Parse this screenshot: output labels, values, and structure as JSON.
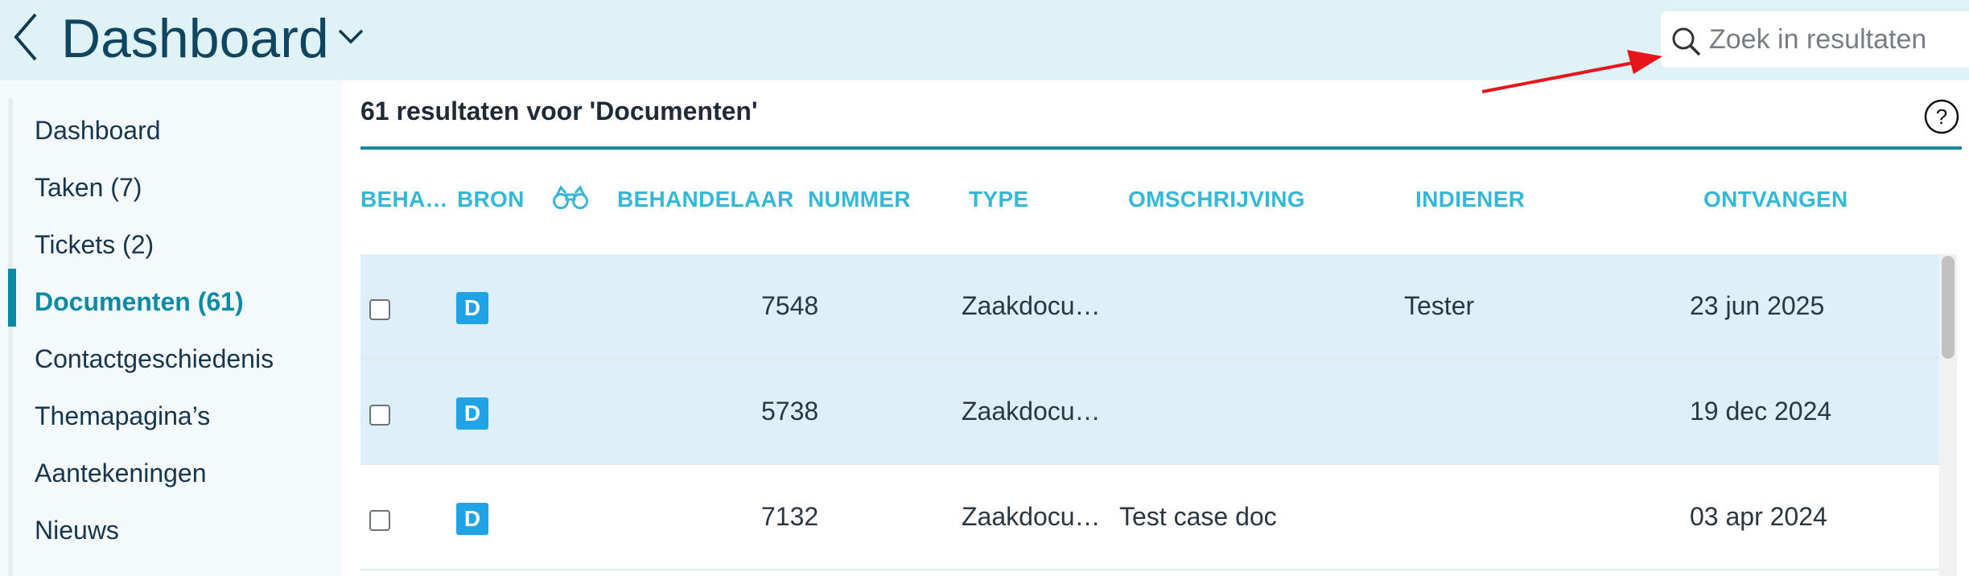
{
  "header": {
    "title": "Dashboard",
    "search_placeholder": "Zoek in resultaten",
    "search_value": ""
  },
  "sidebar": {
    "items": [
      {
        "label": "Dashboard",
        "active": false
      },
      {
        "label": "Taken (7)",
        "active": false
      },
      {
        "label": "Tickets (2)",
        "active": false
      },
      {
        "label": "Documenten (61)",
        "active": true
      },
      {
        "label": "Contactgeschiedenis",
        "active": false
      },
      {
        "label": "Themapagina’s",
        "active": false
      },
      {
        "label": "Aantekeningen",
        "active": false
      },
      {
        "label": "Nieuws",
        "active": false
      }
    ]
  },
  "main": {
    "results_title": "61 resultaten voor 'Documenten'",
    "columns": {
      "beha": "BEHA…",
      "bron": "BRON",
      "behandelaar": "BEHANDELAAR",
      "nummer": "NUMMER",
      "type": "TYPE",
      "omschrijving": "OMSCHRIJVING",
      "indiener": "INDIENER",
      "ontvangen": "ONTVANGEN"
    },
    "rows": [
      {
        "bron": "D",
        "nummer": "7548",
        "type": "Zaakdocu…",
        "omschrijving": "",
        "indiener": "Tester",
        "ontvangen": "23 jun 2025"
      },
      {
        "bron": "D",
        "nummer": "5738",
        "type": "Zaakdocu…",
        "omschrijving": "",
        "indiener": "",
        "ontvangen": "19 dec 2024"
      },
      {
        "bron": "D",
        "nummer": "7132",
        "type": "Zaakdocu…",
        "omschrijving": "Test case doc",
        "indiener": "",
        "ontvangen": "03 apr 2024"
      }
    ]
  },
  "colors": {
    "header_bg": "#dff3f7",
    "accent": "#0b8aa6",
    "column_header": "#35b7d8",
    "row_highlight": "#ddf0fa",
    "badge": "#1fa2e6",
    "annotation_arrow": "#e8141b"
  },
  "icons": [
    "back-chevron-icon",
    "chevron-down-icon",
    "search-icon",
    "help-icon",
    "binoculars-icon"
  ]
}
